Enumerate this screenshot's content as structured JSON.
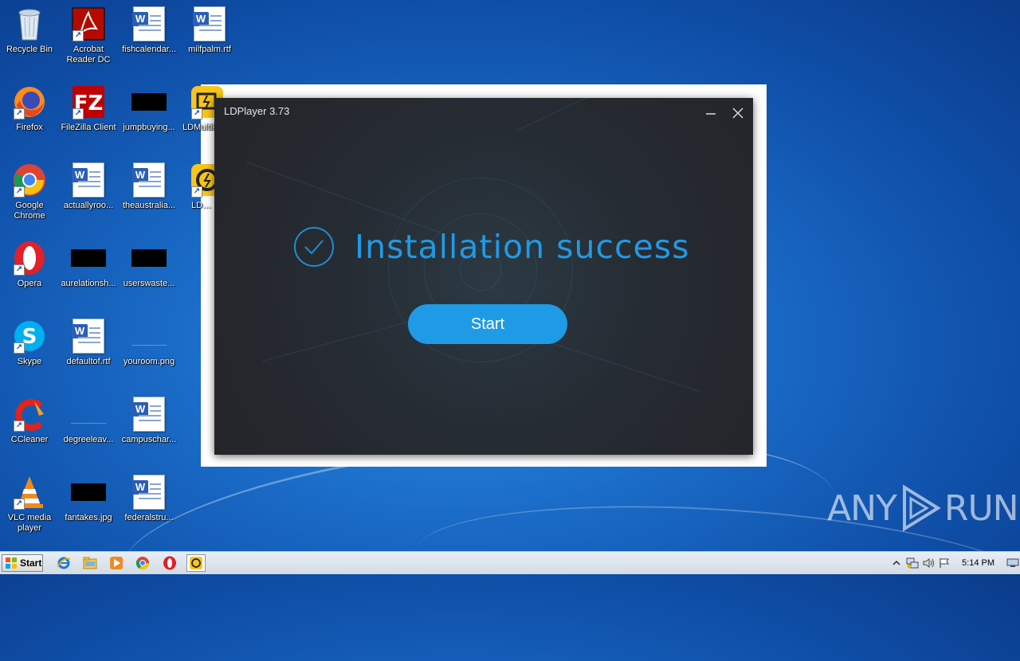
{
  "desktop": {
    "icons": [
      {
        "label": "Recycle Bin"
      },
      {
        "label": "Acrobat\nReader DC"
      },
      {
        "label": "fishcalendar..."
      },
      {
        "label": "milfpalm.rtf"
      },
      {
        "label": "Firefox"
      },
      {
        "label": "FileZilla Client"
      },
      {
        "label": "jumpbuying..."
      },
      {
        "label": "LDMultiP..."
      },
      {
        "label": "Google\nChrome"
      },
      {
        "label": "actuallyroo..."
      },
      {
        "label": "theaustralia..."
      },
      {
        "label": "LDPlay..."
      },
      {
        "label": "Opera"
      },
      {
        "label": "aurelationsh..."
      },
      {
        "label": "userswaste..."
      },
      {
        "label": "Skype"
      },
      {
        "label": "defaultof.rtf"
      },
      {
        "label": "youroom.png"
      },
      {
        "label": "CCleaner"
      },
      {
        "label": "degreeleav..."
      },
      {
        "label": "campuschar..."
      },
      {
        "label": "VLC media\nplayer"
      },
      {
        "label": "fantakes.jpg"
      },
      {
        "label": "federalstru..."
      }
    ]
  },
  "installer": {
    "title": "LDPlayer 3.73",
    "status_text": "Installation success",
    "start_label": "Start",
    "accent_color": "#1f9ae6"
  },
  "taskbar": {
    "start_label": "Start",
    "apps": [
      "internet-explorer",
      "file-explorer",
      "media-player",
      "chrome",
      "opera",
      "ldplayer"
    ],
    "clock": "5:14 PM"
  },
  "watermark": {
    "text_left": "ANY",
    "text_right": "RUN"
  }
}
